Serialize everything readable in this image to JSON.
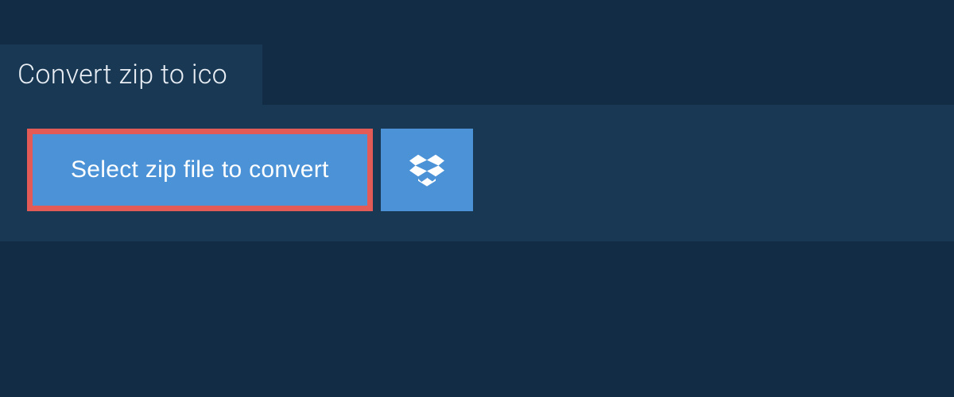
{
  "tab": {
    "title": "Convert zip to ico"
  },
  "actions": {
    "select_file_label": "Select zip file to convert"
  },
  "colors": {
    "page_bg": "#122c46",
    "panel_bg": "#193854",
    "button_bg": "#4b92d6",
    "highlight_border": "#e35b56"
  }
}
